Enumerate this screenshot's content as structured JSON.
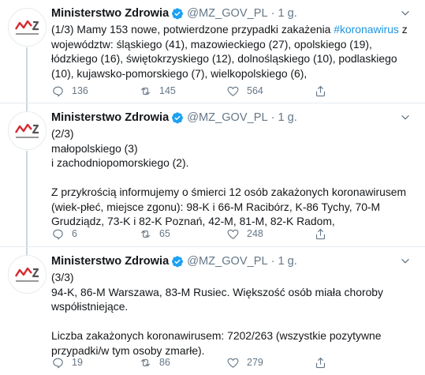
{
  "account": {
    "name": "Ministerstwo Zdrowia",
    "handle": "@MZ_GOV_PL",
    "separator": "·",
    "avatar_text": "Ministerstwo Zdrowia"
  },
  "tweets": [
    {
      "time": "1 g.",
      "text_before": "(1/3) Mamy 153 nowe, potwierdzone przypadki zakażenia ",
      "hashtag": "#koronawirus",
      "text_after": " z województw: śląskiego (41), mazowieckiego (27), opolskiego (19), łódzkiego (16), świętokrzyskiego (12), dolnośląskiego (10), podlaskiego (10), kujawsko-pomorskiego (7), wielkopolskiego (6),",
      "replies": "136",
      "retweets": "145",
      "likes": "564"
    },
    {
      "time": "1 g.",
      "text": "(2/3)\nmałopolskiego (3)\ni zachodniopomorskiego (2).\n\nZ przykrością informujemy o śmierci 12 osób zakażonych koronawirusem (wiek-płeć, miejsce zgonu): 98-K i 66-M Racibórz, K-86 Tychy, 70-M Grudziądz, 73-K i 82-K Poznań, 42-M, 81-M, 82-K Radom,",
      "replies": "6",
      "retweets": "65",
      "likes": "248"
    },
    {
      "time": "1 g.",
      "text": "(3/3)\n94-K, 86-M Warszawa, 83-M Rusiec. Większość osób miała choroby współistniejące.\n\nLiczba zakażonych koronawirusem: 7202/263 (wszystkie pozytywne przypadki/w tym osoby zmarłe).",
      "replies": "19",
      "retweets": "86",
      "likes": "279"
    }
  ],
  "icons": {
    "verified": "verified-badge-icon",
    "caret": "chevron-down-icon",
    "reply": "reply-icon",
    "retweet": "retweet-icon",
    "like": "heart-icon",
    "share": "share-icon"
  },
  "colors": {
    "accent": "#1da1f2",
    "hashtag": "#1b95e0",
    "muted": "#657786",
    "text": "#14171a",
    "logo_red": "#d7282f"
  }
}
